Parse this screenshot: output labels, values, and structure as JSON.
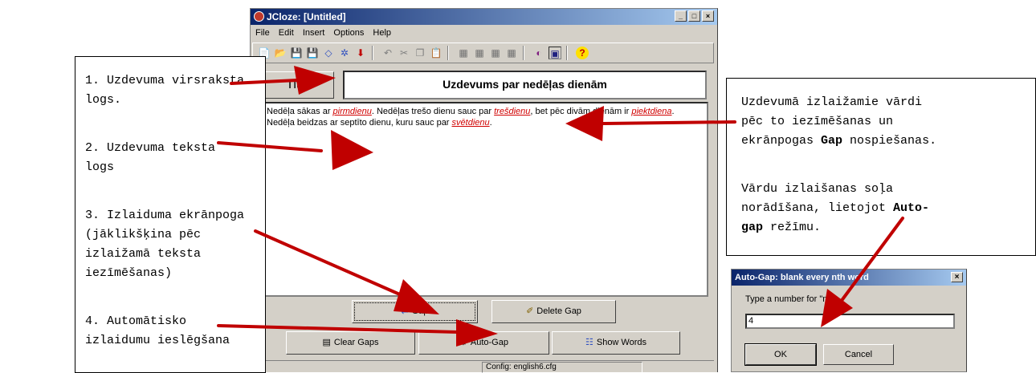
{
  "window": {
    "title": "JCloze: [Untitled]",
    "controls": [
      "_",
      "□",
      "×"
    ],
    "menu": [
      "File",
      "Edit",
      "Insert",
      "Options",
      "Help"
    ],
    "title_button": "Title",
    "title_value": "Uzdevums par nedēļas dienām",
    "text": {
      "t1": "Nedēļa sākas ar ",
      "g1": "pirmdienu",
      "t2": ". Nedēļas trešo dienu sauc par ",
      "g2": "trešdienu",
      "t3": ", bet pēc divām dienām ir ",
      "g3": "piektdiena",
      "t4": ". Nedēļa beidzas ar septīto dienu, kuru sauc par ",
      "g4": "svētdienu",
      "t5": "."
    },
    "buttons": {
      "gap": "Gap",
      "delete_gap": "Delete Gap",
      "clear_gaps": "Clear Gaps",
      "auto_gap": "Auto-Gap",
      "show_words": "Show Words"
    },
    "status": "Config: english6.cfg"
  },
  "dialog": {
    "title": "Auto-Gap: blank every nth word",
    "close": "×",
    "label": "Type a number for \"n\":",
    "value": "4",
    "ok": "OK",
    "cancel": "Cancel"
  },
  "annotations": {
    "a1": "1. Uzdevuma virsraksta\nlogs.",
    "a2": "2. Uzdevuma teksta\nlogs",
    "a3": "3. Izlaiduma ekrānpoga\n(jāklikšķina pēc\nizlaižamā teksta\niezīmēšanas)",
    "a4": "4. Automātisko\nizlaidumu ieslēgšana",
    "r1a": "Uzdevumā izlaižamie vārdi\npēc to iezīmēšanas un\nekrānpogas ",
    "r1b": "Gap",
    "r1c": " nospiešanas.",
    "r2a": "Vārdu izlaišanas soļa\nnorādīšana, lietojot ",
    "r2b": "Auto-\ngap",
    "r2c": " režīmu."
  },
  "colors": {
    "arrow": "#c00000",
    "titlebar_start": "#0a246a",
    "titlebar_end": "#a6caf0",
    "gap_word": "#d00000"
  }
}
